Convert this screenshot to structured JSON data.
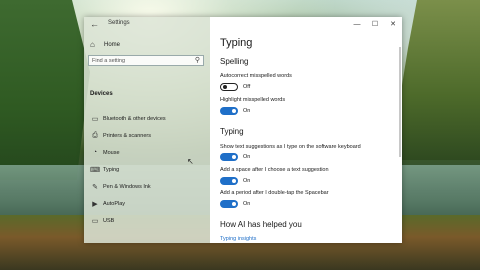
{
  "window": {
    "title": "Settings",
    "back_icon": "back-arrow-icon",
    "minimize_glyph": "—",
    "maximize_glyph": "☐",
    "close_glyph": "✕"
  },
  "sidebar": {
    "home_label": "Home",
    "search_placeholder": "Find a setting",
    "section_label": "Devices",
    "items": [
      {
        "label": "Bluetooth & other devices",
        "icon": "bluetooth-icon",
        "glyph": "▭"
      },
      {
        "label": "Printers & scanners",
        "icon": "printer-icon",
        "glyph": "⎙"
      },
      {
        "label": "Mouse",
        "icon": "mouse-icon",
        "glyph": "◔"
      },
      {
        "label": "Typing",
        "icon": "keyboard-icon",
        "glyph": "⌨"
      },
      {
        "label": "Pen & Windows Ink",
        "icon": "pen-icon",
        "glyph": "✎"
      },
      {
        "label": "AutoPlay",
        "icon": "autoplay-icon",
        "glyph": "▶"
      },
      {
        "label": "USB",
        "icon": "usb-icon",
        "glyph": "▭"
      }
    ]
  },
  "main": {
    "page_title": "Typing",
    "spelling": {
      "heading": "Spelling",
      "autocorrect_label": "Autocorrect misspelled words",
      "autocorrect_state": "Off",
      "highlight_label": "Highlight misspelled words",
      "highlight_state": "On"
    },
    "typing": {
      "heading": "Typing",
      "suggestions_label": "Show text suggestions as I type on the software keyboard",
      "suggestions_state": "On",
      "space_label": "Add a space after I choose a text suggestion",
      "space_state": "On",
      "period_label": "Add a period after I double-tap the Spacebar",
      "period_state": "On"
    },
    "ai": {
      "heading": "How AI has helped you",
      "link": "Typing insights"
    }
  }
}
